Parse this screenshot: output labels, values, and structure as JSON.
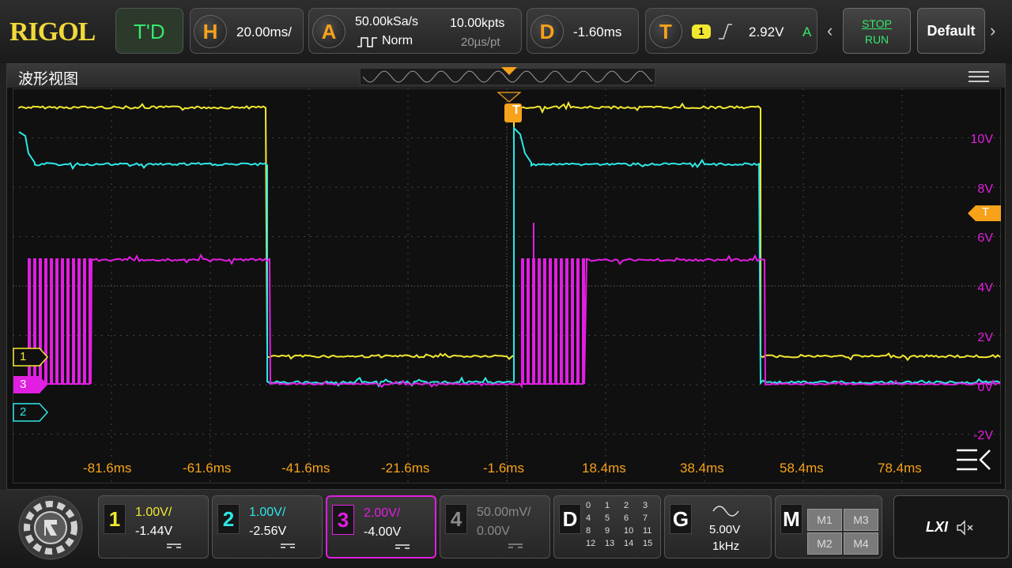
{
  "header": {
    "brand": "RIGOL",
    "mode": "T'D",
    "horizontal": {
      "badge": "H",
      "timebase": "20.00ms/"
    },
    "acquire": {
      "badge": "A",
      "sample_rate": "50.00kSa/s",
      "memory_depth": "10.00kpts",
      "mode": "Norm",
      "resolution": "20µs/pt"
    },
    "delay": {
      "badge": "D",
      "value": "-1.60ms"
    },
    "trigger": {
      "badge": "T",
      "source": "1",
      "level": "2.92V",
      "sweep": "A"
    },
    "stop_run": {
      "line1": "STOP",
      "line2": "RUN"
    },
    "default_button": "Default"
  },
  "panel": {
    "title": "波形视图",
    "trigger_marker": "T",
    "right_trigger_marker": "T",
    "time_labels": [
      "-81.6ms",
      "-61.6ms",
      "-41.6ms",
      "-21.6ms",
      "-1.6ms",
      "18.4ms",
      "38.4ms",
      "58.4ms",
      "78.4ms"
    ],
    "volt_labels": [
      "10V",
      "8V",
      "6V",
      "4V",
      "2V",
      "0V",
      "-2V"
    ],
    "channel_markers": [
      "1",
      "3",
      "2"
    ]
  },
  "bottom": {
    "channels": [
      {
        "num": "1",
        "scale": "1.00V/",
        "offset": "-1.44V",
        "color": "#f2e830"
      },
      {
        "num": "2",
        "scale": "1.00V/",
        "offset": "-2.56V",
        "color": "#2ee6e6"
      },
      {
        "num": "3",
        "scale": "2.00V/",
        "offset": "-4.00V",
        "color": "#e11ee1"
      },
      {
        "num": "4",
        "scale": "50.00mV/",
        "offset": "0.00V",
        "color": "#8a8a8a"
      }
    ],
    "digital": {
      "label": "D",
      "numbers": [
        "0",
        "1",
        "2",
        "3",
        "4",
        "5",
        "6",
        "7",
        "8",
        "9",
        "10",
        "11",
        "12",
        "13",
        "14",
        "15"
      ]
    },
    "generator": {
      "label": "G",
      "amplitude": "5.00V",
      "frequency": "1kHz"
    },
    "math": {
      "label": "M",
      "items": [
        "M1",
        "M3",
        "M2",
        "M4"
      ]
    },
    "lxi": "LXI"
  },
  "colors": {
    "ch1": "#f2e830",
    "ch2": "#2ee6e6",
    "ch3": "#e11ee1",
    "trigger": "#f7a21b",
    "grid": "#4a4a4a"
  },
  "icons": [
    "home-gear-icon",
    "menu-icon",
    "collapse-arrows-icon",
    "speaker-mute-icon",
    "sine-wave-icon",
    "pulse-icon",
    "rising-edge-icon"
  ]
}
